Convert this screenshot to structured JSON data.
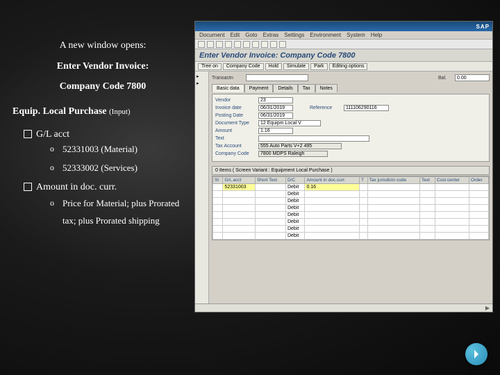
{
  "slide": {
    "intro": "A new window opens:",
    "title1": "Enter Vendor Invoice:",
    "title2": "Company Code 7800",
    "section": "Equip. Local Purchase",
    "input_note": "(Input)",
    "items": {
      "gl_label": "G/L acct",
      "gl1": "52331003 (Material)",
      "gl2": "52333002 (Services)",
      "amount_label": "Amount in doc. curr.",
      "amount_detail": "Price for Material; plus Prorated tax; plus Prorated shipping"
    }
  },
  "sap": {
    "titlebar_left": "",
    "titlebar_right": "SAP",
    "menu": [
      "Document",
      "Edit",
      "Goto",
      "Extras",
      "Settings",
      "Environment",
      "System",
      "Help"
    ],
    "subtitle": "Enter Vendor Invoice: Company Code 7800",
    "toolbar2": [
      "Tree on",
      "Company Code",
      "Hold",
      "Simulate",
      "Park",
      "Editing options"
    ],
    "header": {
      "transactn_lbl": "Transactn",
      "transactn_val": "",
      "bal_lbl": "Bal.",
      "bal_val": "0.00"
    },
    "tabs": [
      "Basic data",
      "Payment",
      "Details",
      "Tax",
      "Notes"
    ],
    "form": {
      "vendor_lbl": "Vendor",
      "vendor_val": "23",
      "invdate_lbl": "Invoice date",
      "invdate_val": "06/31/2019",
      "reference_lbl": "Reference",
      "reference_val": "111106290116",
      "postdate_lbl": "Posting Date",
      "postdate_val": "06/31/2019",
      "doctype_lbl": "Document Type",
      "doctype_val": "12 Equipm Local V",
      "amount_lbl": "Amount",
      "amount_val": "1.16",
      "text_lbl": "Text",
      "text_val": "",
      "taxacct_lbl": "Tax Account",
      "taxacct_val": "555 Auto Parts V+2 495",
      "company_lbl": "Company Code",
      "company_val": "7800 MDPS Raleigh"
    },
    "grid_title": "0 Items ( Screen Variant : Equipment Local Purchase )",
    "grid_cols": [
      "St",
      "G/L acct",
      "Short Text",
      "D/C",
      "Amount in doc.curr.",
      "T",
      "Tax jurisdictn code",
      "Text",
      "Cost center",
      "Order"
    ],
    "grid_rows": [
      {
        "gl": "52331003",
        "dc": "Debit",
        "amt": "0.16",
        "y": true
      },
      {
        "gl": "",
        "dc": "Debit",
        "amt": "",
        "y": false
      },
      {
        "gl": "",
        "dc": "Debit",
        "amt": "",
        "y": false
      },
      {
        "gl": "",
        "dc": "Debit",
        "amt": "",
        "y": false
      },
      {
        "gl": "",
        "dc": "Debit",
        "amt": "",
        "y": false
      },
      {
        "gl": "",
        "dc": "Debit",
        "amt": "",
        "y": false
      },
      {
        "gl": "",
        "dc": "Debit",
        "amt": "",
        "y": false
      },
      {
        "gl": "",
        "dc": "Debit",
        "amt": "",
        "y": false
      }
    ]
  }
}
